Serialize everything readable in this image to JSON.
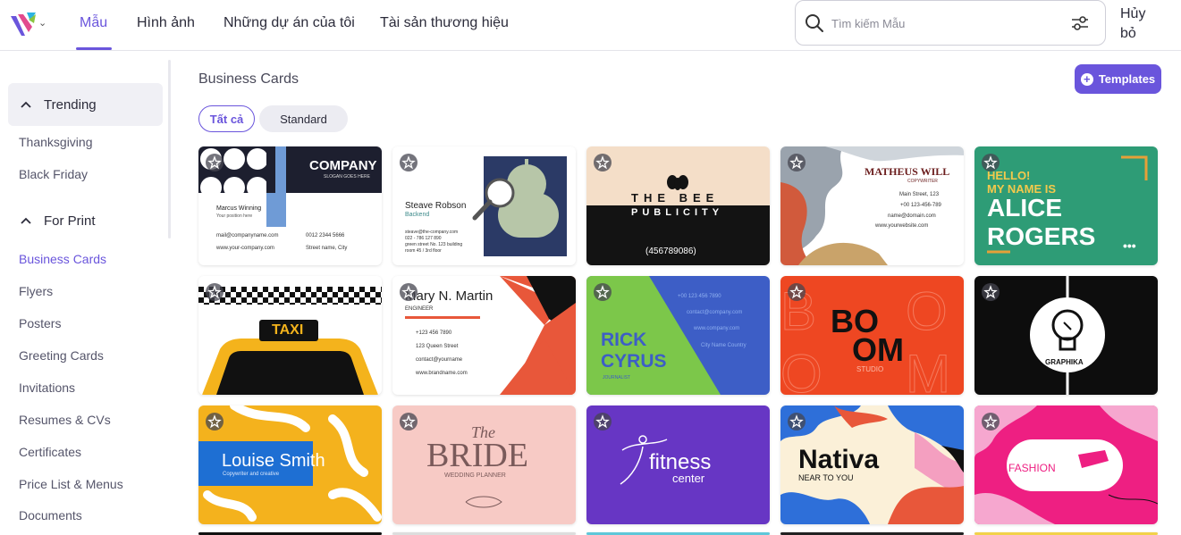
{
  "header": {
    "nav_tabs": [
      "Mẫu",
      "Hình ảnh",
      "Những dự án của tôi",
      "Tài sản thương hiệu"
    ],
    "active_tab": "Mẫu",
    "search_placeholder": "Tìm kiếm Mẫu",
    "cancel_label": "Hủy\nbỏ",
    "cancel_line1": "Hủy",
    "cancel_line2": "bỏ"
  },
  "sidebar": {
    "section_trending": "Trending",
    "trending_items": [
      "Thanksgiving",
      "Black Friday"
    ],
    "section_print": "For Print",
    "print_items": [
      "Business Cards",
      "Flyers",
      "Posters",
      "Greeting Cards",
      "Invitations",
      "Resumes & CVs",
      "Certificates",
      "Price List & Menus",
      "Documents"
    ],
    "active_item": "Business Cards"
  },
  "main": {
    "title": "Business Cards",
    "templates_button": "Templates",
    "filter_chips": [
      "Tất cả",
      "Standard"
    ],
    "active_chip": "Tất cả"
  },
  "cards": {
    "c1": {
      "company": "COMPANY",
      "slogan": "SLOGAN GOES HERE",
      "name": "Marcus Winning",
      "title": "Your position here",
      "email": "mail@companyname.com",
      "phone": "0012 2344 5666",
      "web": "www.your-company.com",
      "street": "Street name, City"
    },
    "c2": {
      "name": "Steave Robson",
      "role": "Backend",
      "email": "steave@the-company.com",
      "phone": "022 - 786 127 890",
      "address1": "green street No. 123 building",
      "address2": "room 45 / 3rd floor"
    },
    "c3": {
      "line1": "THE BEE",
      "line2": "PUBLICITY",
      "phone": "(456789086)"
    },
    "c4": {
      "name": "MATHEUS WILL",
      "role": "COPYWRITER",
      "street": "Main Street, 123",
      "phone": "+00 123-456-789",
      "email": "name@domain.com",
      "web": "www.yourwebsite.com"
    },
    "c5": {
      "hello": "HELLO!",
      "myname": "MY NAME IS",
      "first": "ALICE",
      "last": "ROGERS",
      "dots": "•••"
    },
    "c6": {
      "sign": "TAXI"
    },
    "c7": {
      "name": "Mary N. Martin",
      "role": "ENGINEER",
      "phone": "+123 456 7890",
      "street": "123 Queen Street",
      "email": "contact@yourname",
      "web": "www.brandname.com"
    },
    "c8": {
      "first": "RICK",
      "last": "CYRUS",
      "role": "JOURNALIST",
      "phone": "+00 123 456 7890",
      "email": "contact@company.com",
      "web": "www.company.com",
      "city": "City Name Country"
    },
    "c9": {
      "line1": "BO",
      "line2": "OM",
      "studio": "STUDIO"
    },
    "c10": {
      "brand": "GRAPHIKA"
    },
    "c11": {
      "name": "Louise Smith",
      "role": "Copywriter and creative"
    },
    "c12": {
      "the": "The",
      "bride": "BRIDE",
      "role": "WEDDING PLANNER"
    },
    "c13": {
      "brand": "fitness",
      "sub": "center"
    },
    "c14": {
      "brand": "Nativa",
      "sub": "NEAR TO YOU"
    },
    "c15": {
      "brand": "FASHION"
    }
  },
  "colors": {
    "accent": "#6a55dc",
    "text": "#2b2b3a"
  }
}
